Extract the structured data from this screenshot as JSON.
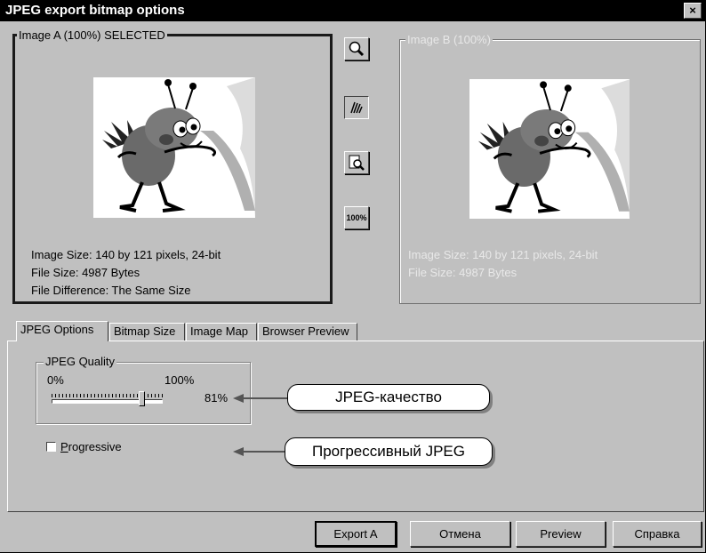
{
  "window": {
    "title": "JPEG export bitmap options",
    "close_label": "×"
  },
  "image_a": {
    "legend": "Image A (100%) SELECTED",
    "size": "Image Size: 140 by 121 pixels, 24-bit",
    "file_size": "File Size: 4987 Bytes",
    "difference": "File Difference: The Same Size"
  },
  "image_b": {
    "legend": "Image B (100%)",
    "size": "Image Size: 140 by 121 pixels, 24-bit",
    "file_size": "File Size: 4987 Bytes"
  },
  "tools": {
    "zoom_label": "100%"
  },
  "tabs": [
    {
      "label": "JPEG Options",
      "active": true
    },
    {
      "label": "Bitmap Size",
      "active": false
    },
    {
      "label": "Image Map",
      "active": false
    },
    {
      "label": "Browser Preview",
      "active": false
    }
  ],
  "jpeg_quality": {
    "legend": "JPEG Quality",
    "min_label": "0%",
    "max_label": "100%",
    "value_label": "81%",
    "value": 81
  },
  "progressive": {
    "label_first": "P",
    "label_rest": "rogressive",
    "checked": false
  },
  "callouts": {
    "quality": "JPEG-качество",
    "progressive": "Прогрессивный JPEG"
  },
  "buttons": {
    "export": "Export A",
    "cancel": "Отмена",
    "preview": "Preview",
    "help": "Справка"
  },
  "colors": {
    "dialog_bg": "#c0c0c0",
    "title_bg": "#000000",
    "disabled_text": "#e8e8e8"
  }
}
